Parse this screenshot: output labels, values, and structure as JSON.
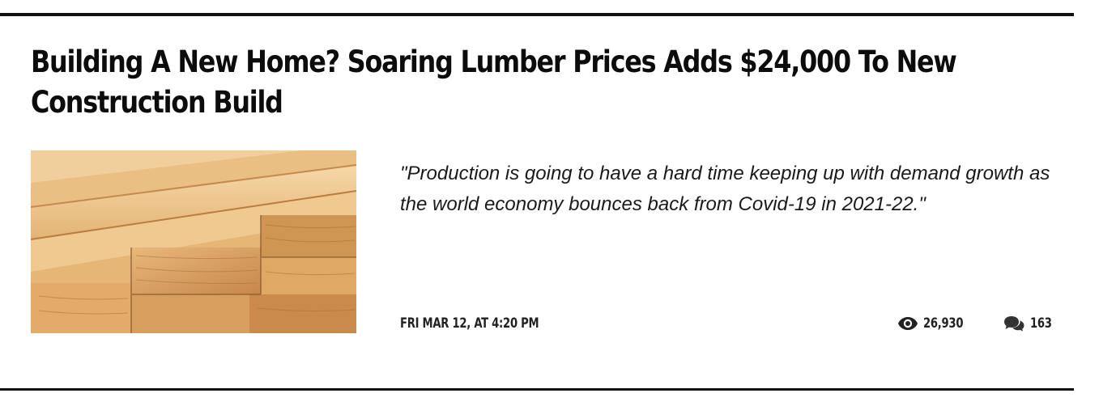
{
  "article": {
    "title": "Building A New Home? Soaring Lumber Prices Adds $24,000 To New Construction Build",
    "teaser": "\"Production is going to have a hard time keeping up with demand growth as the world economy bounces back from Covid-19 in 2021-22.\"",
    "date": "FRI MAR 12, AT 4:20 PM",
    "views": "26,930",
    "comments": "163",
    "thumbnail_alt": "Stacked lumber boards"
  },
  "icons": {
    "views": "eye-icon",
    "comments": "comments-icon"
  },
  "colors": {
    "text": "#111111",
    "rule": "#111111",
    "wood_light": "#efc68e",
    "wood_dark": "#c98a4c"
  }
}
